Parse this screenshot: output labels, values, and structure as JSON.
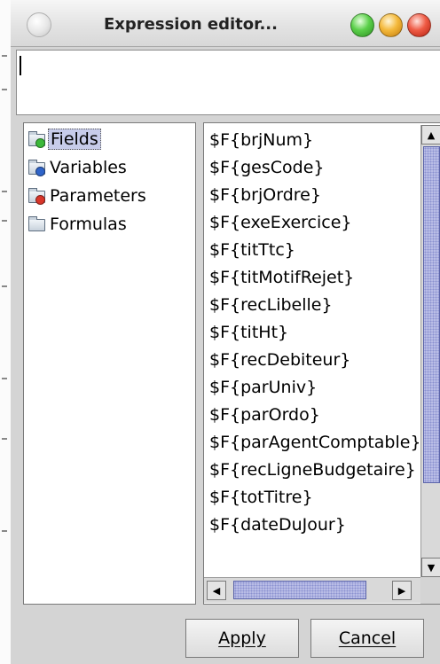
{
  "window": {
    "title": "Expression editor..."
  },
  "expression": {
    "value": ""
  },
  "tree": {
    "items": [
      {
        "label": "Fields",
        "icon": "folder-green-icon",
        "selected": true
      },
      {
        "label": "Variables",
        "icon": "folder-blue-icon",
        "selected": false
      },
      {
        "label": "Parameters",
        "icon": "folder-red-icon",
        "selected": false
      },
      {
        "label": "Formulas",
        "icon": "folder-icon",
        "selected": false
      }
    ]
  },
  "fields": {
    "items": [
      "$F{brjNum}",
      "$F{gesCode}",
      "$F{brjOrdre}",
      "$F{exeExercice}",
      "$F{titTtc}",
      "$F{titMotifRejet}",
      "$F{recLibelle}",
      "$F{titHt}",
      "$F{recDebiteur}",
      "$F{parUniv}",
      "$F{parOrdo}",
      "$F{parAgentComptable}",
      "$F{recLigneBudgetaire}",
      "$F{totTitre}",
      "$F{dateDuJour}"
    ]
  },
  "buttons": {
    "apply": "Apply",
    "cancel": "Cancel"
  },
  "colors": {
    "selection": "#c7ccea",
    "scrollbar_thumb": "#b9bde6"
  }
}
